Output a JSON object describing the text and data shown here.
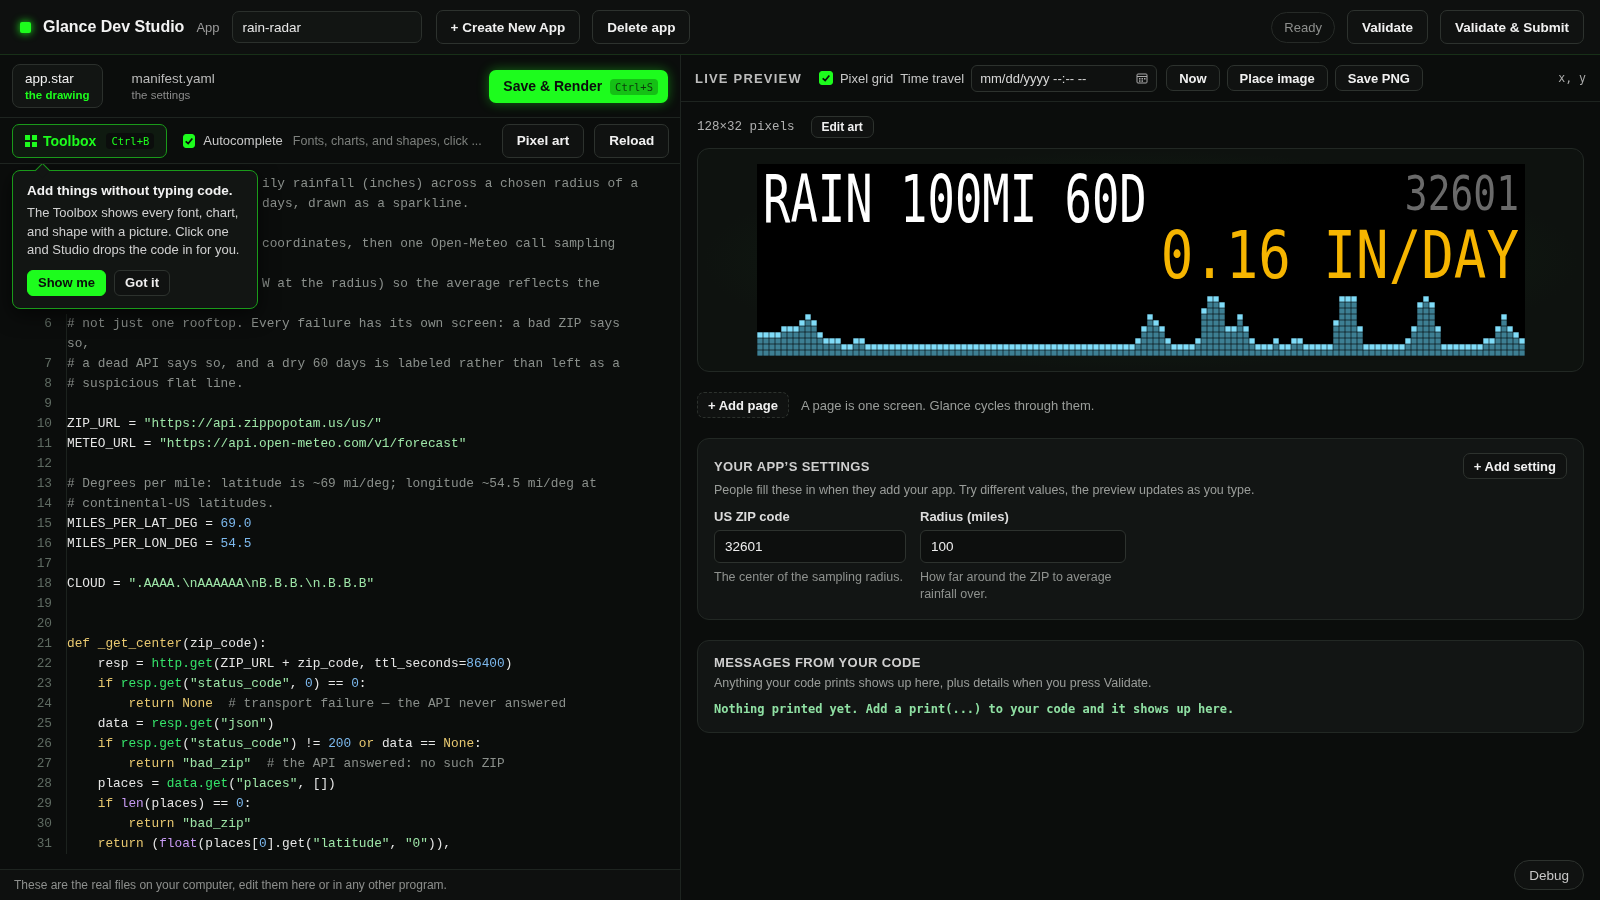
{
  "app_bar": {
    "title": "Glance Dev Studio",
    "app_label": "App",
    "app_name": "rain-radar",
    "buttons": [
      "+ Create New App",
      "Delete app"
    ],
    "status": "Ready",
    "actions": [
      "Validate",
      "Validate & Submit"
    ]
  },
  "files": [
    {
      "name": "app.star",
      "caption": "the drawing",
      "selected": true
    },
    {
      "name": "manifest.yaml",
      "caption": "the settings",
      "selected": false
    }
  ],
  "save_button": {
    "label": "Save & Render",
    "shortcut": "Ctrl+S"
  },
  "toolbar": {
    "toolbox": {
      "label": "Toolbox",
      "shortcut": "Ctrl+B",
      "expanded": true
    },
    "autocomplete": {
      "label": "Autocomplete",
      "checked": true
    },
    "hint": "Fonts, charts, and shapes, click ...",
    "buttons": [
      "Pixel art",
      "Reload"
    ]
  },
  "tip": {
    "title": "Add things without typing code.",
    "body": "The Toolbox shows every font, chart, and shape with a picture. Click one and Studio drops the code in for you.",
    "buttons": [
      "Show me",
      "Got it"
    ]
  },
  "editor": {
    "covered_lines": [
      {
        "text": "ily rainfall (inches) across a chosen radius of a",
        "blank_after": false
      },
      {
        "text": "days, drawn as a sparkline.",
        "blank_after": true
      },
      {
        "text": "coordinates, then one Open-Meteo call sampling",
        "blank_after": true
      },
      {
        "text": "W at the radius) so the average reflects the",
        "blank_after": true
      }
    ],
    "lines": [
      {
        "number": "6",
        "tokens": [
          {
            "kind": "comment",
            "text": "# not just one rooftop. Every failure has its own screen: a bad ZIP says so,"
          }
        ]
      },
      {
        "number": "7",
        "tokens": [
          {
            "kind": "comment",
            "text": "# a dead API says so, and a dry 60 days is labeled rather than left as a"
          }
        ]
      },
      {
        "number": "8",
        "tokens": [
          {
            "kind": "comment",
            "text": "# suspicious flat line."
          }
        ]
      },
      {
        "number": "9"
      },
      {
        "number": "10",
        "tokens": [
          {
            "kind": "plain",
            "text": "ZIP_URL = "
          },
          {
            "kind": "string",
            "text": "\"https://api.zippopotam.us/us/\""
          }
        ]
      },
      {
        "number": "11",
        "tokens": [
          {
            "kind": "plain",
            "text": "METEO_URL = "
          },
          {
            "kind": "string",
            "text": "\"https://api.open-meteo.com/v1/forecast\""
          }
        ]
      },
      {
        "number": "12"
      },
      {
        "number": "13",
        "tokens": [
          {
            "kind": "comment",
            "text": "# Degrees per mile: latitude is ~69 mi/deg; longitude ~54.5 mi/deg at"
          }
        ]
      },
      {
        "number": "14",
        "tokens": [
          {
            "kind": "comment",
            "text": "# continental-US latitudes."
          }
        ]
      },
      {
        "number": "15",
        "tokens": [
          {
            "kind": "plain",
            "text": "MILES_PER_LAT_DEG = "
          },
          {
            "kind": "number",
            "text": "69.0"
          }
        ]
      },
      {
        "number": "16",
        "tokens": [
          {
            "kind": "plain",
            "text": "MILES_PER_LON_DEG = "
          },
          {
            "kind": "number",
            "text": "54.5"
          }
        ]
      },
      {
        "number": "17"
      },
      {
        "number": "18",
        "tokens": [
          {
            "kind": "plain",
            "text": "CLOUD = "
          },
          {
            "kind": "string",
            "text": "\".AAAA.\\nAAAAAA\\nB.B.B.\\n.B.B.B\""
          }
        ]
      },
      {
        "number": "19"
      },
      {
        "number": "20"
      },
      {
        "number": "21",
        "tokens": [
          {
            "kind": "keyword",
            "text": "def _get_center"
          },
          {
            "kind": "plain",
            "text": "(zip_code):"
          }
        ],
        "children": [
          {
            "number": "22",
            "tokens": [
              {
                "kind": "plain",
                "text": "resp = "
              },
              {
                "kind": "call",
                "text": "http.get"
              },
              {
                "kind": "plain",
                "text": "(ZIP_URL + zip_code, ttl_seconds="
              },
              {
                "kind": "number",
                "text": "86400"
              },
              {
                "kind": "plain",
                "text": ")"
              }
            ]
          },
          {
            "number": "23",
            "tokens": [
              {
                "kind": "keyword",
                "text": "if "
              },
              {
                "kind": "call",
                "text": "resp.get"
              },
              {
                "kind": "plain",
                "text": "("
              },
              {
                "kind": "string",
                "text": "\"status_code\""
              },
              {
                "kind": "plain",
                "text": ", "
              },
              {
                "kind": "number",
                "text": "0"
              },
              {
                "kind": "plain",
                "text": ") == "
              },
              {
                "kind": "number",
                "text": "0"
              },
              {
                "kind": "plain",
                "text": ":"
              }
            ],
            "children": [
              {
                "number": "24",
                "tokens": [
                  {
                    "kind": "keyword",
                    "text": "return None  "
                  },
                  {
                    "kind": "comment",
                    "text": "# transport failure — the API never answered"
                  }
                ]
              }
            ]
          },
          {
            "number": "25",
            "tokens": [
              {
                "kind": "plain",
                "text": "data = "
              },
              {
                "kind": "call",
                "text": "resp.get"
              },
              {
                "kind": "plain",
                "text": "("
              },
              {
                "kind": "string",
                "text": "\"json\""
              },
              {
                "kind": "plain",
                "text": ")"
              }
            ]
          },
          {
            "number": "26",
            "tokens": [
              {
                "kind": "keyword",
                "text": "if "
              },
              {
                "kind": "call",
                "text": "resp.get"
              },
              {
                "kind": "plain",
                "text": "("
              },
              {
                "kind": "string",
                "text": "\"status_code\""
              },
              {
                "kind": "plain",
                "text": ") != "
              },
              {
                "kind": "number",
                "text": "200"
              },
              {
                "kind": "keyword",
                "text": " or"
              },
              {
                "kind": "plain",
                "text": " data == "
              },
              {
                "kind": "keyword",
                "text": "None"
              },
              {
                "kind": "plain",
                "text": ":"
              }
            ],
            "children": [
              {
                "number": "27",
                "tokens": [
                  {
                    "kind": "keyword",
                    "text": "return "
                  },
                  {
                    "kind": "string",
                    "text": "\"bad_zip\"  "
                  },
                  {
                    "kind": "comment",
                    "text": "# the API answered: no such ZIP"
                  }
                ]
              }
            ]
          },
          {
            "number": "28",
            "tokens": [
              {
                "kind": "plain",
                "text": "places = "
              },
              {
                "kind": "call",
                "text": "data.get"
              },
              {
                "kind": "plain",
                "text": "("
              },
              {
                "kind": "string",
                "text": "\"places\""
              },
              {
                "kind": "plain",
                "text": ", [])"
              }
            ]
          },
          {
            "number": "29",
            "tokens": [
              {
                "kind": "keyword",
                "text": "if "
              },
              {
                "kind": "builtin",
                "text": "len"
              },
              {
                "kind": "plain",
                "text": "(places) == "
              },
              {
                "kind": "number",
                "text": "0"
              },
              {
                "kind": "plain",
                "text": ":"
              }
            ],
            "children": [
              {
                "number": "30",
                "tokens": [
                  {
                    "kind": "keyword",
                    "text": "return "
                  },
                  {
                    "kind": "string",
                    "text": "\"bad_zip\""
                  }
                ]
              }
            ]
          },
          {
            "number": "31",
            "tokens": [
              {
                "kind": "keyword",
                "text": "return"
              },
              {
                "kind": "plain",
                "text": " ("
              },
              {
                "kind": "builtin",
                "text": "float"
              },
              {
                "kind": "plain",
                "text": "(places["
              },
              {
                "kind": "number",
                "text": "0"
              },
              {
                "kind": "plain",
                "text": "].get("
              },
              {
                "kind": "string",
                "text": "\"latitude\""
              },
              {
                "kind": "plain",
                "text": ", "
              },
              {
                "kind": "string",
                "text": "\"0\""
              },
              {
                "kind": "plain",
                "text": ")),"
              }
            ]
          }
        ]
      }
    ]
  },
  "footer": "These are the real files on your computer, edit them here or in any other program.",
  "preview": {
    "title": "LIVE PREVIEW",
    "pixel_grid": {
      "label": "Pixel grid",
      "checked": true
    },
    "time_travel": {
      "label": "Time travel",
      "placeholder": "mm/dd/yyyy --:-- --"
    },
    "buttons": [
      "Now",
      "Place image",
      "Save PNG"
    ],
    "cursor": "x, y",
    "size": "128×32 pixels",
    "edit_button": "Edit art",
    "display": {
      "heading": "RAIN 100MI 60D",
      "zip": "32601",
      "reading": "0.16 IN/DAY"
    },
    "add_page": "+ Add page",
    "add_page_hint": "A page is one screen. Glance cycles through them."
  },
  "settings": {
    "title": "YOUR APP’S SETTINGS",
    "add_button": "+ Add setting",
    "description": "People fill these in when they add your app. Try different values, the preview updates as you type.",
    "fields": [
      {
        "label": "US ZIP code",
        "value": "32601",
        "help": "The center of the sampling radius."
      },
      {
        "label": "Radius (miles)",
        "value": "100",
        "help": "How far around the ZIP to average rainfall over."
      }
    ]
  },
  "messages": {
    "title": "MESSAGES FROM YOUR CODE",
    "description": "Anything your code prints shows up here, plus details when you press Validate.",
    "output": "Nothing printed yet. Add a print(...) to your code and it shows up here."
  },
  "debug_button": "Debug"
}
